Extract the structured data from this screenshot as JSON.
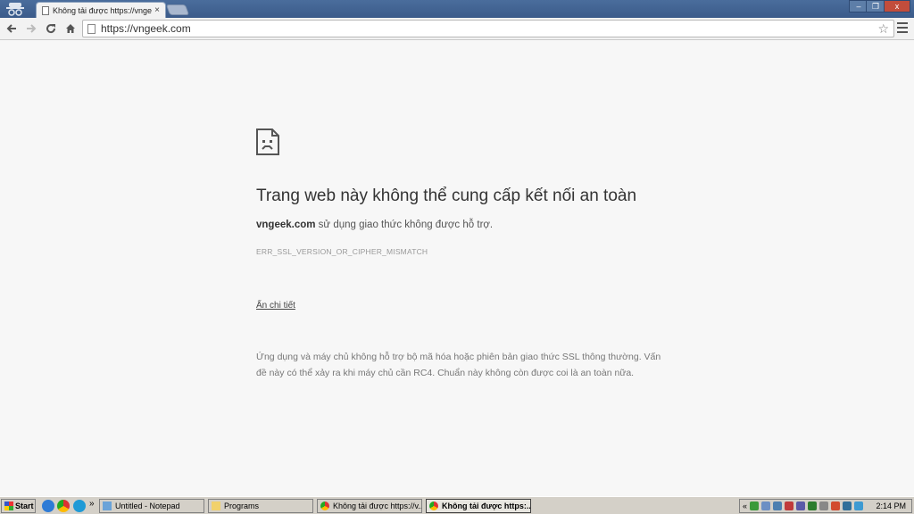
{
  "browser": {
    "tab_title": "Không tải được https://vnge",
    "tab_close": "×",
    "url": "https://vngeek.com",
    "window_controls": {
      "minimize": "–",
      "maximize": "❐",
      "close": "x"
    }
  },
  "error_page": {
    "title": "Trang web này không thể cung cấp kết nối an toàn",
    "host": "vngeek.com",
    "summary_rest": " sử dụng giao thức không được hỗ trợ.",
    "error_code": "ERR_SSL_VERSION_OR_CIPHER_MISMATCH",
    "details_link": "Ẩn chi tiết",
    "details_text": "Ứng dụng và máy chủ không hỗ trợ bộ mã hóa hoặc phiên bản giao thức SSL thông thường. Vấn đề này có thể xảy ra khi máy chủ cần RC4. Chuẩn này không còn được coi là an toàn nữa."
  },
  "taskbar": {
    "start_label": "Start",
    "chevron": "»",
    "tasks": [
      {
        "label": "Untitled - Notepad"
      },
      {
        "label": "Programs"
      },
      {
        "label": "Không tải được https://v..."
      },
      {
        "label": "Không tải được https:..."
      }
    ],
    "tray_chevron": "«",
    "clock": "2:14 PM"
  },
  "colors": {
    "titlebar": "#3b5b8a",
    "page_background": "#f7f7f7",
    "taskbar": "#d4d0c8"
  }
}
